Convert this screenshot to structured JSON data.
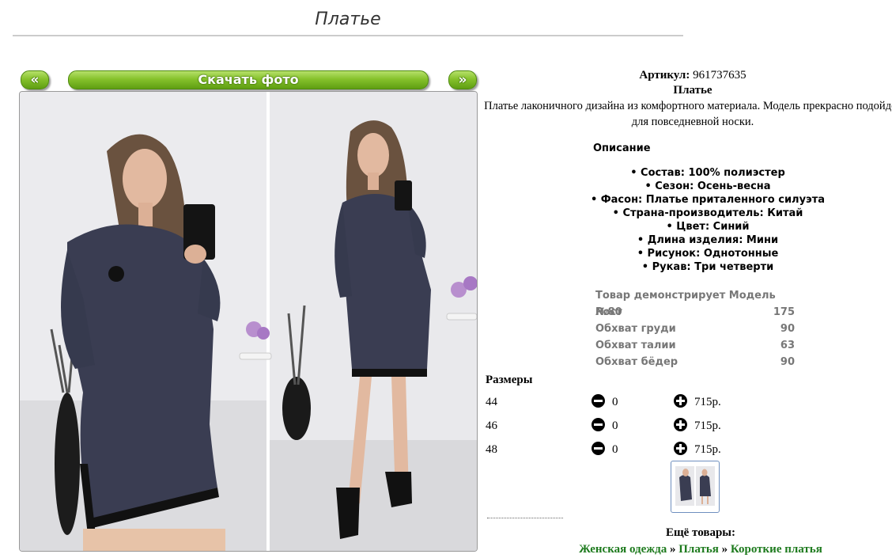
{
  "page": {
    "title": "Платье"
  },
  "gallery": {
    "prev_label": "«",
    "download_label": "Скачать фото",
    "next_label": "»",
    "colors": {
      "button": "#7fbf28",
      "dress": "#3a3d52",
      "background": "#e9e9ec"
    }
  },
  "product": {
    "article_label": "Артикул:",
    "article_value": "961737635",
    "name": "Платье",
    "description": "Платье лаконичного дизайна из комфортного материала. Модель прекрасно подойдет для повседневной носки."
  },
  "properties": {
    "heading": "Описание",
    "items": [
      "• Состав: 100% полиэстер",
      "• Сезон: Осень-весна",
      "• Фасон: Платье приталенного силуэта",
      "• Страна-производитель: Китай",
      "• Цвет: Синий",
      "• Длина изделия: Мини",
      "• Рисунок: Однотонные",
      "• Рукав: Три четверти"
    ]
  },
  "model": {
    "rows": [
      {
        "label": "Товар демонстрирует Модель №80",
        "value": ""
      },
      {
        "label": "Рост",
        "value": "175"
      },
      {
        "label": "Обхват груди",
        "value": "90"
      },
      {
        "label": "Обхват талии",
        "value": "63"
      },
      {
        "label": "Обхват бёдер",
        "value": "90"
      }
    ]
  },
  "sizes": {
    "heading": "Размеры",
    "rows": [
      {
        "size": "44",
        "qty": "0",
        "price": "715р."
      },
      {
        "size": "46",
        "qty": "0",
        "price": "715р."
      },
      {
        "size": "48",
        "qty": "0",
        "price": "715р."
      }
    ]
  },
  "more": {
    "heading": "Ещё товары:",
    "crumbs": [
      "Женская одежда",
      "Платья",
      "Короткие платья"
    ],
    "separator": "»"
  }
}
